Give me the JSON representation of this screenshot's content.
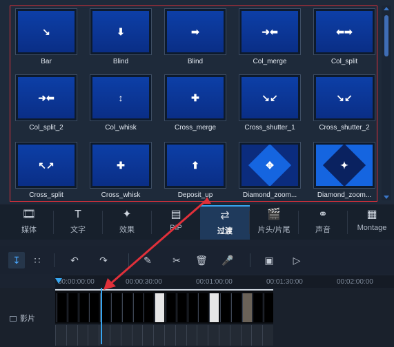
{
  "transitions": [
    {
      "label": "Bar",
      "icon": "arrow-down-right-icon"
    },
    {
      "label": "Blind",
      "icon": "arrow-down-icon"
    },
    {
      "label": "Blind",
      "icon": "arrow-right-icon"
    },
    {
      "label": "Col_merge",
      "icon": "arrows-inward-icon"
    },
    {
      "label": "Col_split",
      "icon": "arrows-outward-icon"
    },
    {
      "label": "Col_split_2",
      "icon": "arrows-inward-icon"
    },
    {
      "label": "Col_whisk",
      "icon": "arrows-up-down-icon"
    },
    {
      "label": "Cross_merge",
      "icon": "arrows-center-icon"
    },
    {
      "label": "Cross_shutter_1",
      "icon": "arrows-diagonal-icon"
    },
    {
      "label": "Cross_shutter_2",
      "icon": "arrows-diagonal-icon"
    },
    {
      "label": "Cross_split",
      "icon": "arrows-corners-icon"
    },
    {
      "label": "Cross_whisk",
      "icon": "plus-arrows-icon"
    },
    {
      "label": "Deposit_up",
      "icon": "arrow-up-icon"
    },
    {
      "label": "Diamond_zoom...",
      "icon": "diamond-expand-icon"
    },
    {
      "label": "Diamond_zoom...",
      "icon": "diamond-collapse-icon"
    }
  ],
  "tabs": [
    {
      "label": "媒体",
      "icon": "film-icon"
    },
    {
      "label": "文字",
      "icon": "text-icon"
    },
    {
      "label": "效果",
      "icon": "magic-wand-icon"
    },
    {
      "label": "PIP",
      "icon": "pip-icon"
    },
    {
      "label": "过渡",
      "icon": "transition-icon",
      "active": true
    },
    {
      "label": "片头/片尾",
      "icon": "clapper-icon"
    },
    {
      "label": "声音",
      "icon": "headphones-icon"
    },
    {
      "label": "Montage",
      "icon": "montage-icon"
    }
  ],
  "toolbar": {
    "tools": [
      "timeline-view-icon",
      "storyboard-view-icon",
      "undo-icon",
      "redo-icon",
      "edit-clip-icon",
      "cut-icon",
      "delete-icon",
      "microphone-icon",
      "crop-icon",
      "export-icon"
    ]
  },
  "timeline": {
    "ticks": [
      "00:00:00:00",
      "00:00:30:00",
      "00:01:00:00",
      "00:01:30:00",
      "00:02:00:00"
    ],
    "track_label": "影片"
  },
  "colors": {
    "accent": "#37a6f0",
    "highlight": "#e0303a",
    "tile_blue": "#0d3fa7"
  }
}
